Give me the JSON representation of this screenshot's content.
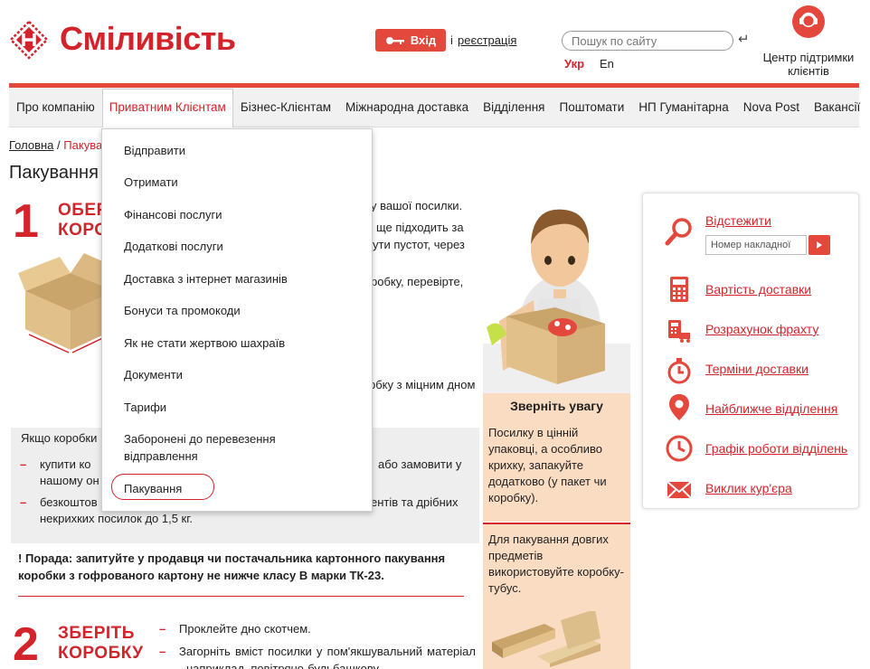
{
  "header": {
    "logo_text": "Сміливість",
    "login_label": "Вхід",
    "login_or": "і",
    "register_label": "реєстрація",
    "search_placeholder": "Пошук по сайту",
    "lang_ukr": "Укр",
    "lang_en": "En",
    "support_label": "Центр підтримки клієнтів"
  },
  "nav": {
    "items": [
      "Про компанію",
      "Приватним Клієнтам",
      "Бізнес-Клієнтам",
      "Міжнародна доставка",
      "Відділення",
      "Поштомати",
      "НП Гуманітарна",
      "Nova Post",
      "Вакансії"
    ],
    "active_index": 1
  },
  "breadcrumb": {
    "home": "Головна",
    "separator": "/",
    "current": "Пакува"
  },
  "page_title": "Пакування",
  "dropdown": {
    "items": [
      "Відправити",
      "Отримати",
      "Фінансові послуги",
      "Додаткові послуги",
      "Доставка з інтернет магазинів",
      "Бонуси та промокоди",
      "Як не стати жертвою шахраїв",
      "Документи",
      "Тарифи",
      "Заборонені до перевезення відправлення",
      "Пакування"
    ],
    "selected": "Пакування"
  },
  "step1": {
    "number": "1",
    "title_line1": "ОБЕР",
    "title_line2": "КОРО",
    "text_lines": [
      "у вашої посилки.",
      "ще підходить за",
      "ути пустот, через",
      "робку, перевірте,",
      "рбку з міцним дном"
    ]
  },
  "gray_panel": {
    "intro": "Якщо коробки",
    "bullet1_line1": "купити ко",
    "bullet1_right": "або замовити у",
    "bullet1_line2": "нашому он",
    "bullet2_line1": "безкоштов",
    "bullet2_right": "ентів та дрібних",
    "bullet2_line2": "некрихких посилок до 1,5 кг."
  },
  "tip": "! Порада: запитуйте у продавця чи постачальника картонного пакування коробки з гофрованого картону не нижче класу В марки ТК-23.",
  "step2": {
    "number": "2",
    "title_line1": "ЗБЕРІТЬ",
    "title_line2": "КОРОБКУ",
    "bullet1": "Проклейте дно скотчем.",
    "bullet2": "Загорніть вміст посилки у пом'якшувальний матеріал - наприклад, повітряно-бульбашкову"
  },
  "attention": {
    "title": "Зверніть увагу",
    "text": "Посилку в цінній упаковці, а особливо крихку, запакуйте додатково (у пакет чи коробку).",
    "text2": "Для пакування довгих предметів використовуйте коробку-тубус."
  },
  "right_panel": {
    "track_label": "Відстежити",
    "track_placeholder": "Номер накладної",
    "items": [
      "Вартість доставки",
      "Розрахунок фрахту",
      "Терміни доставки",
      "Найближче відділення",
      "Графік роботи відділень",
      "Виклик кур'єра"
    ],
    "icons": [
      "search-icon",
      "calculator-icon",
      "freight-icon",
      "stopwatch-icon",
      "location-pin-icon",
      "clock-icon",
      "envelope-icon"
    ]
  },
  "colors": {
    "brand_red": "#d3242b",
    "button_red": "#e4473b",
    "attention_bg": "#f9dcc2",
    "nav_bg": "#f1f1f1"
  }
}
